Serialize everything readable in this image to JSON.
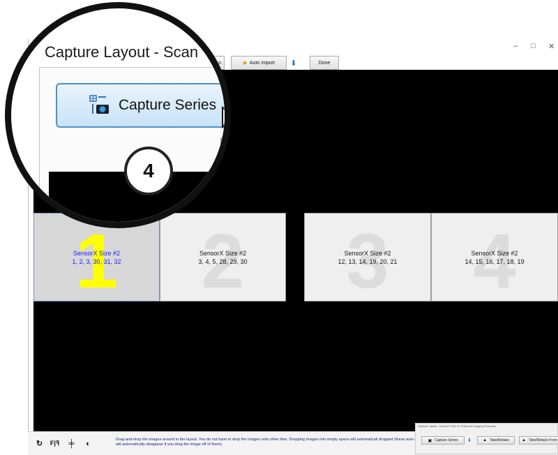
{
  "window": {
    "title": "Capture Layout - Scan",
    "controls": {
      "minimize": "–",
      "maximize": "□",
      "close": "✕"
    }
  },
  "toolbar": {
    "partial_label": "n",
    "auto_import_label": "Auto Import",
    "done_label": "Done"
  },
  "magnifier": {
    "title": "Capture Layout - Scan",
    "capture_series_label": "Capture Series",
    "step_badge": "4"
  },
  "tiles": [
    {
      "number": "1",
      "title": "SensorX Size #2",
      "teeth": "1, 2, 3, 30, 31, 32",
      "selected": true
    },
    {
      "number": "2",
      "title": "SensorX Size #2",
      "teeth": "3, 4, 5, 28, 29, 30",
      "selected": false
    },
    {
      "number": "3",
      "title": "SensorX Size #2",
      "teeth": "12, 13, 14, 19, 20, 21",
      "selected": false
    },
    {
      "number": "4",
      "title": "SensorX Size #2",
      "teeth": "14, 15, 16, 17, 18, 19",
      "selected": false
    }
  ],
  "bottom": {
    "tools": [
      "rotate-icon",
      "flip-horizontal-icon",
      "flip-vertical-icon",
      "contrast-icon"
    ],
    "hint": "Drag-and-drop the images around in the layout.  You do not have to drop the images onto other tiles.  Dropping images into empty space will automaticall dropped (these auto-tiles will automatically disappear if you drag the image off of them)."
  },
  "mini_window": {
    "title": "Capture Layout - SensorX Size #2 Preferred Imaging Extension",
    "capture_series_label": "Capture Series",
    "take_retake_label": "Take/Retake",
    "take_retake_from_label": "Take/Retake From"
  },
  "colors": {
    "accent_blue": "#2f6ed8",
    "selected_number": "#ffff00",
    "selected_text": "#1a1aff",
    "canvas": "#000000"
  }
}
